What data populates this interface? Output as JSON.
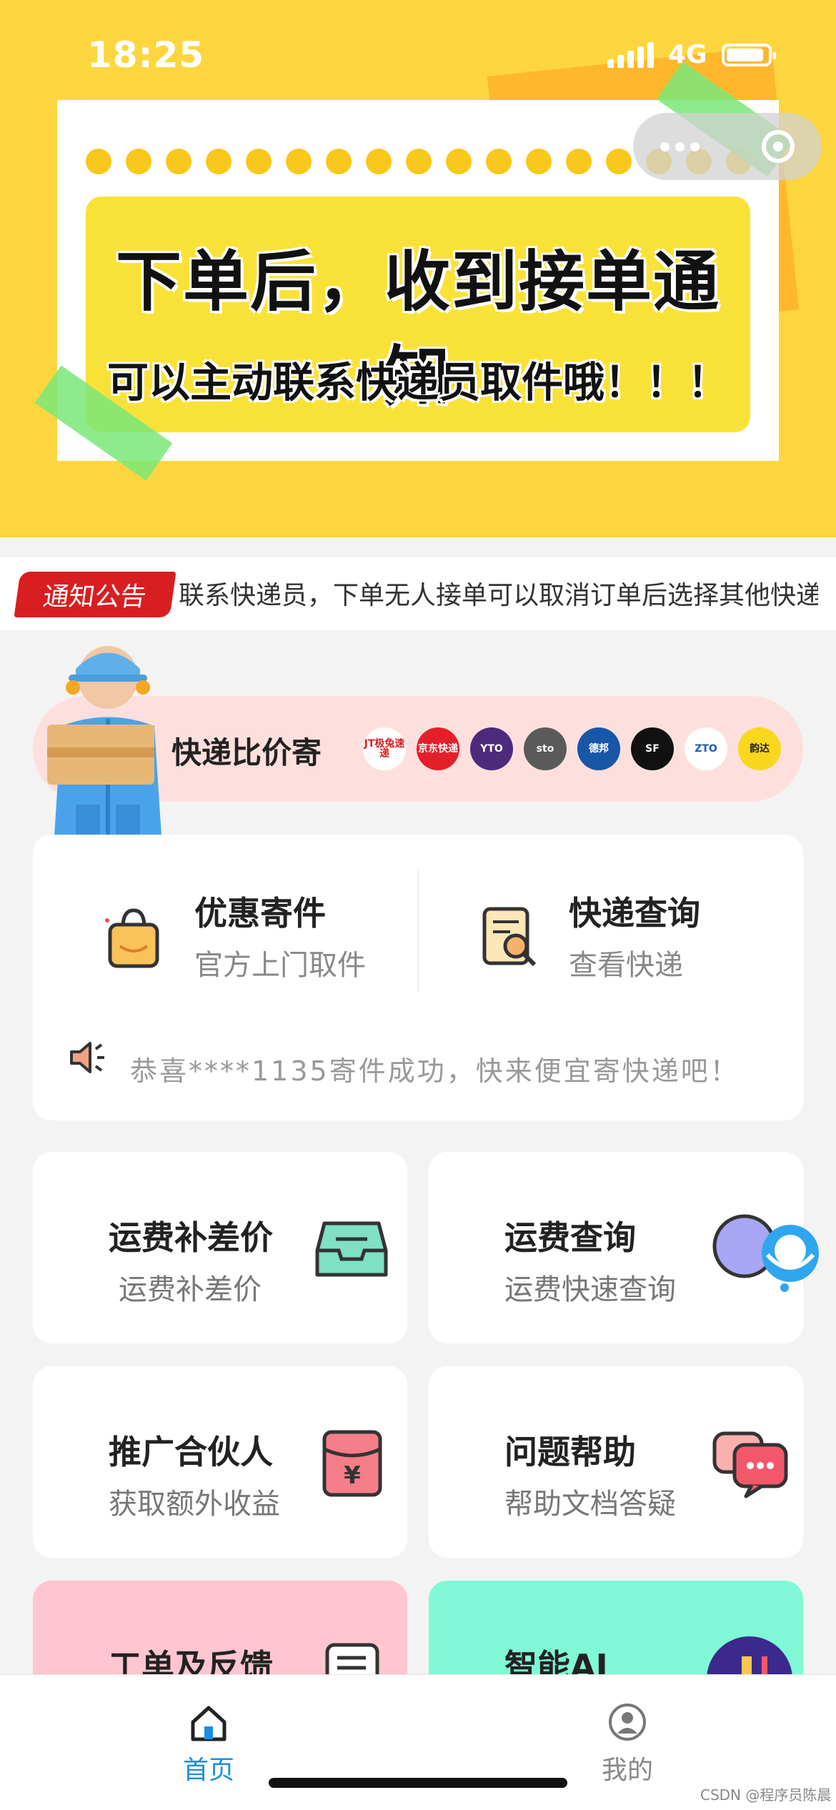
{
  "status_bar": {
    "time": "18:25",
    "network": "4G"
  },
  "banner": {
    "headline": "下单后，收到接单通知",
    "subline": "可以主动联系快递员取件哦！！！"
  },
  "notice": {
    "tag": "通知公告",
    "text": "联系快递员，下单无人接单可以取消订单后选择其他快递"
  },
  "compare": {
    "title": "快递比价寄",
    "couriers": [
      {
        "name": "JT极兔速递",
        "color": "#ffffff",
        "text_color": "#d81e20"
      },
      {
        "name": "京东快递",
        "color": "#e3202a",
        "text_color": "#ffffff"
      },
      {
        "name": "YTO",
        "color": "#4d2a7c",
        "text_color": "#ffffff"
      },
      {
        "name": "sto",
        "color": "#5a5a5a",
        "text_color": "#ffffff"
      },
      {
        "name": "德邦",
        "color": "#1856a8",
        "text_color": "#ffffff"
      },
      {
        "name": "SF",
        "color": "#111111",
        "text_color": "#ffffff"
      },
      {
        "name": "ZTO",
        "color": "#ffffff",
        "text_color": "#1a5fb4"
      },
      {
        "name": "韵达",
        "color": "#f9d71c",
        "text_color": "#222222"
      }
    ]
  },
  "services": {
    "send": {
      "title": "优惠寄件",
      "subtitle": "官方上门取件",
      "icon": "shopping-bag-icon"
    },
    "track": {
      "title": "快递查询",
      "subtitle": "查看快递",
      "icon": "document-search-icon"
    },
    "ticker": "恭喜****1135寄件成功，快来便宜寄快递吧！"
  },
  "grid": [
    {
      "title": "运费补差价",
      "subtitle": "运费补差价",
      "icon": "inbox-tray-icon"
    },
    {
      "title": "运费查询",
      "subtitle": "运费快速查询",
      "icon": "search-globe-icon"
    },
    {
      "title": "推广合伙人",
      "subtitle": "获取额外收益",
      "icon": "red-envelope-icon"
    },
    {
      "title": "问题帮助",
      "subtitle": "帮助文档答疑",
      "icon": "chat-bubbles-icon"
    },
    {
      "title": "工单及反馈",
      "subtitle": "",
      "icon": "ticket-icon",
      "bg": "#ffc5d0"
    },
    {
      "title": "智能AI",
      "subtitle": "",
      "icon": "ai-icon",
      "bg": "#80f8d6"
    }
  ],
  "tabs": [
    {
      "label": "首页",
      "icon": "home-icon",
      "active": true,
      "color": "#1a8fe3"
    },
    {
      "label": "我的",
      "icon": "user-icon",
      "active": false,
      "color": "#888888"
    }
  ],
  "watermark": "CSDN @程序员陈晨"
}
